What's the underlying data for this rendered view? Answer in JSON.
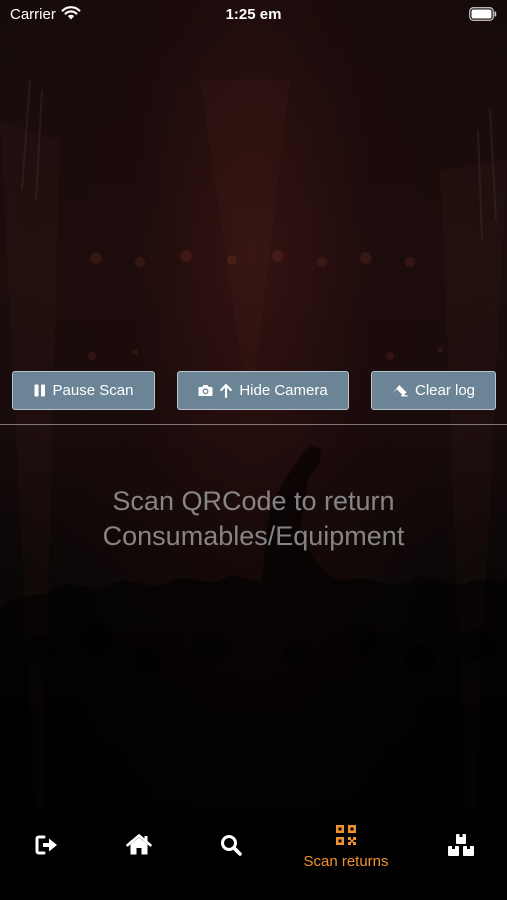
{
  "status_bar": {
    "carrier": "Carrier",
    "time": "1:25 em",
    "wifi_icon": "wifi-icon",
    "battery_icon": "battery-icon"
  },
  "actions": {
    "pause_scan": {
      "label": "Pause Scan",
      "icon": "pause-icon"
    },
    "hide_camera": {
      "label": "Hide Camera",
      "icons": [
        "camera-icon",
        "arrow-up-icon"
      ]
    },
    "clear_log": {
      "label": "Clear log",
      "icon": "eraser-icon"
    }
  },
  "message": {
    "line1": "Scan QRCode to return",
    "line2": "Consumables/Equipment"
  },
  "tab_bar": {
    "items": [
      {
        "icon": "logout-icon",
        "label": ""
      },
      {
        "icon": "home-icon",
        "label": ""
      },
      {
        "icon": "search-icon",
        "label": ""
      },
      {
        "icon": "qrcode-icon",
        "label": "Scan returns",
        "active": true
      },
      {
        "icon": "boxes-icon",
        "label": ""
      }
    ]
  },
  "colors": {
    "button_bg": "#6b8597",
    "button_border": "#b7c4cc",
    "active_tab": "#f0922e",
    "message_text": "#969696",
    "tab_bar_bg": "#000000"
  }
}
